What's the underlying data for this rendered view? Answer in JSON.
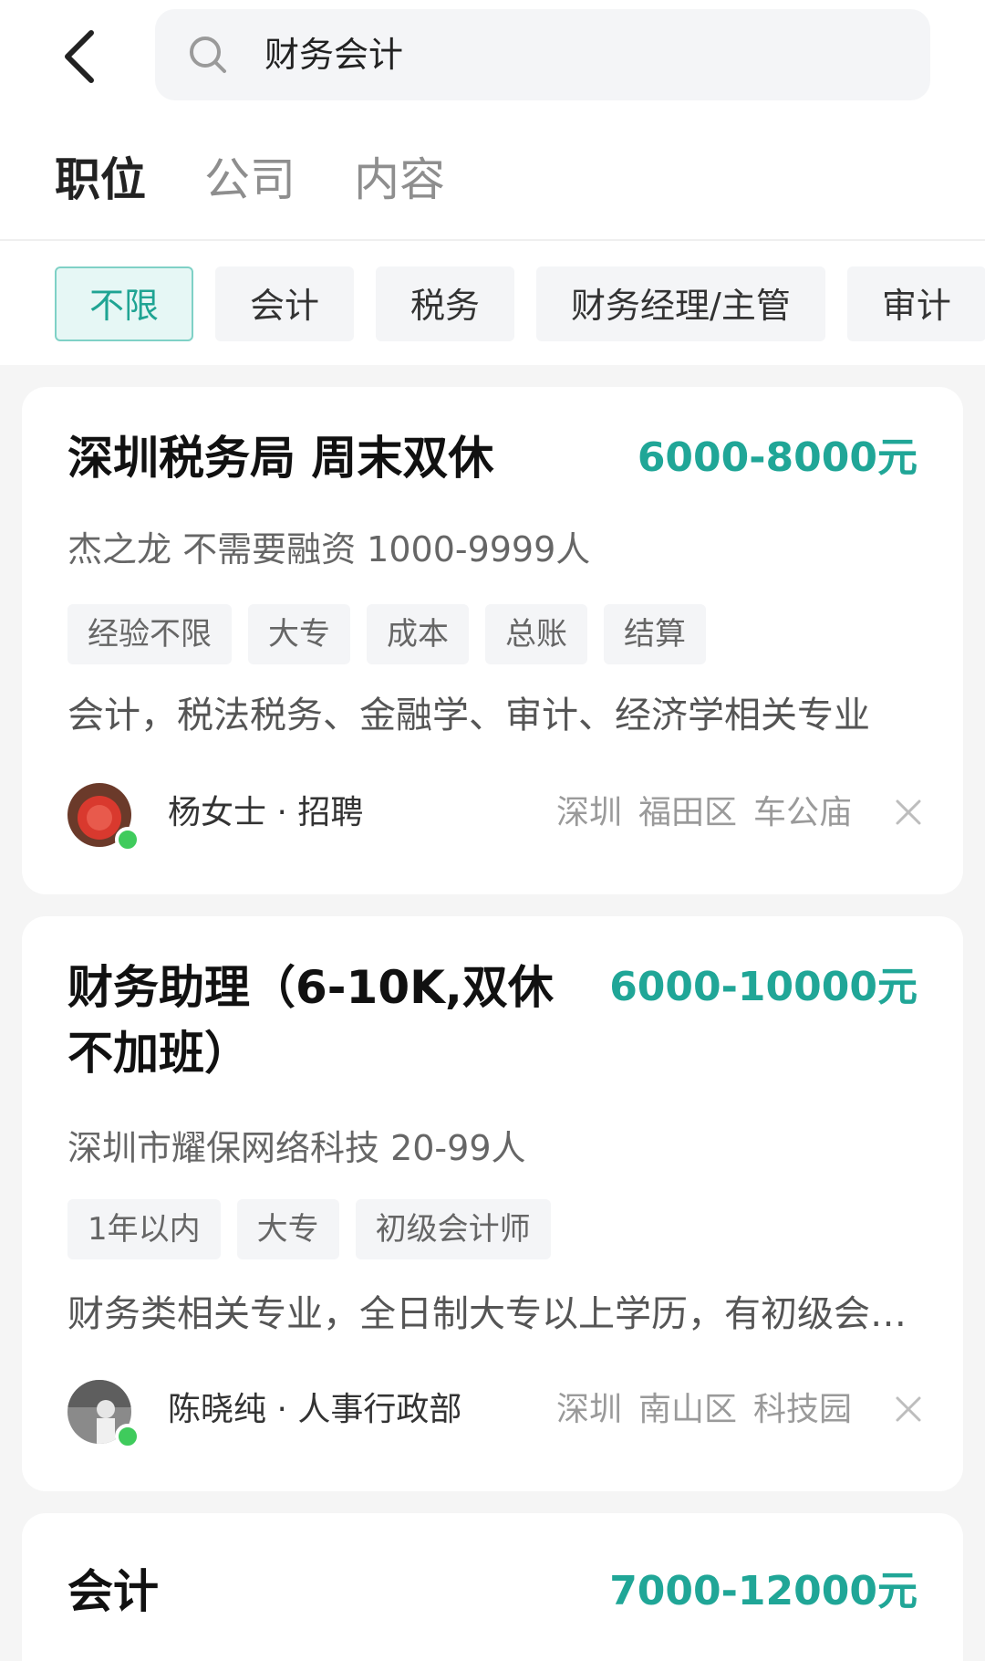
{
  "search": {
    "query": "财务会计"
  },
  "tabs": [
    {
      "label": "职位",
      "active": true
    },
    {
      "label": "公司",
      "active": false
    },
    {
      "label": "内容",
      "active": false
    }
  ],
  "filters": [
    {
      "label": "不限",
      "active": true
    },
    {
      "label": "会计",
      "active": false
    },
    {
      "label": "税务",
      "active": false
    },
    {
      "label": "财务经理/主管",
      "active": false
    },
    {
      "label": "审计",
      "active": false
    }
  ],
  "jobs": [
    {
      "title": "深圳税务局  周末双休",
      "salary": "6000-8000元",
      "company": "杰之龙  不需要融资  1000-9999人",
      "tags": [
        "经验不限",
        "大专",
        "成本",
        "总账",
        "结算"
      ],
      "description": "会计，税法税务、金融学、审计、经济学相关专业",
      "recruiter": "杨女士 · 招聘",
      "location": {
        "city": "深圳",
        "district": "福田区",
        "area": "车公庙"
      }
    },
    {
      "title": "财务助理（6-10K,双休不加班）",
      "salary": "6000-10000元",
      "company": "深圳市耀保网络科技  20-99人",
      "tags": [
        "1年以内",
        "大专",
        "初级会计师"
      ],
      "description": "财务类相关专业，全日制大专以上学历，有初级会计证",
      "recruiter": "陈晓纯 · 人事行政部",
      "location": {
        "city": "深圳",
        "district": "南山区",
        "area": "科技园"
      }
    },
    {
      "title": "会计",
      "salary": "7000-12000元"
    }
  ],
  "colors": {
    "accent": "#20a697",
    "chip_active_bg": "#e6f7f5",
    "online": "#3fcb5c"
  }
}
